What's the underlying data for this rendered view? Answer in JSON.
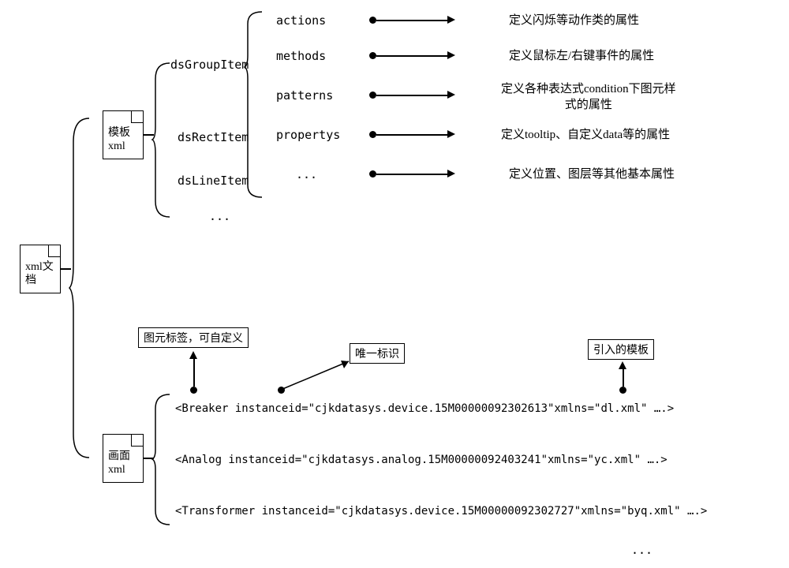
{
  "root": {
    "label": "xml文\n档"
  },
  "template": {
    "label": "模板\nxml",
    "children": [
      "dsGroupItem",
      "dsRectItem",
      "dsLineItem",
      "..."
    ]
  },
  "dsGroup_children": [
    {
      "term": "actions",
      "desc": "定义闪烁等动作类的属性"
    },
    {
      "term": "methods",
      "desc": "定义鼠标左/右键事件的属性"
    },
    {
      "term": "patterns",
      "desc": "定义各种表达式condition下图元样\n式的属性"
    },
    {
      "term": "propertys",
      "desc": "定义tooltip、自定义data等的属性"
    },
    {
      "term": "...",
      "desc": "定义位置、图层等其他基本属性"
    }
  ],
  "screen": {
    "label": "画面\nxml",
    "callouts": {
      "tag_label": "图元标签，可自定义",
      "uid": "唯一标识",
      "tpl_ref": "引入的模板"
    },
    "lines": [
      "<Breaker instanceid=\"cjkdatasys.device.15M00000092302613\"xmlns=\"dl.xml\" ….>",
      "<Analog instanceid=\"cjkdatasys.analog.15M00000092403241\"xmlns=\"yc.xml\" ….>",
      "<Transformer instanceid=\"cjkdatasys.device.15M00000092302727\"xmlns=\"byq.xml\" ….>"
    ]
  },
  "ellipsis": "..."
}
